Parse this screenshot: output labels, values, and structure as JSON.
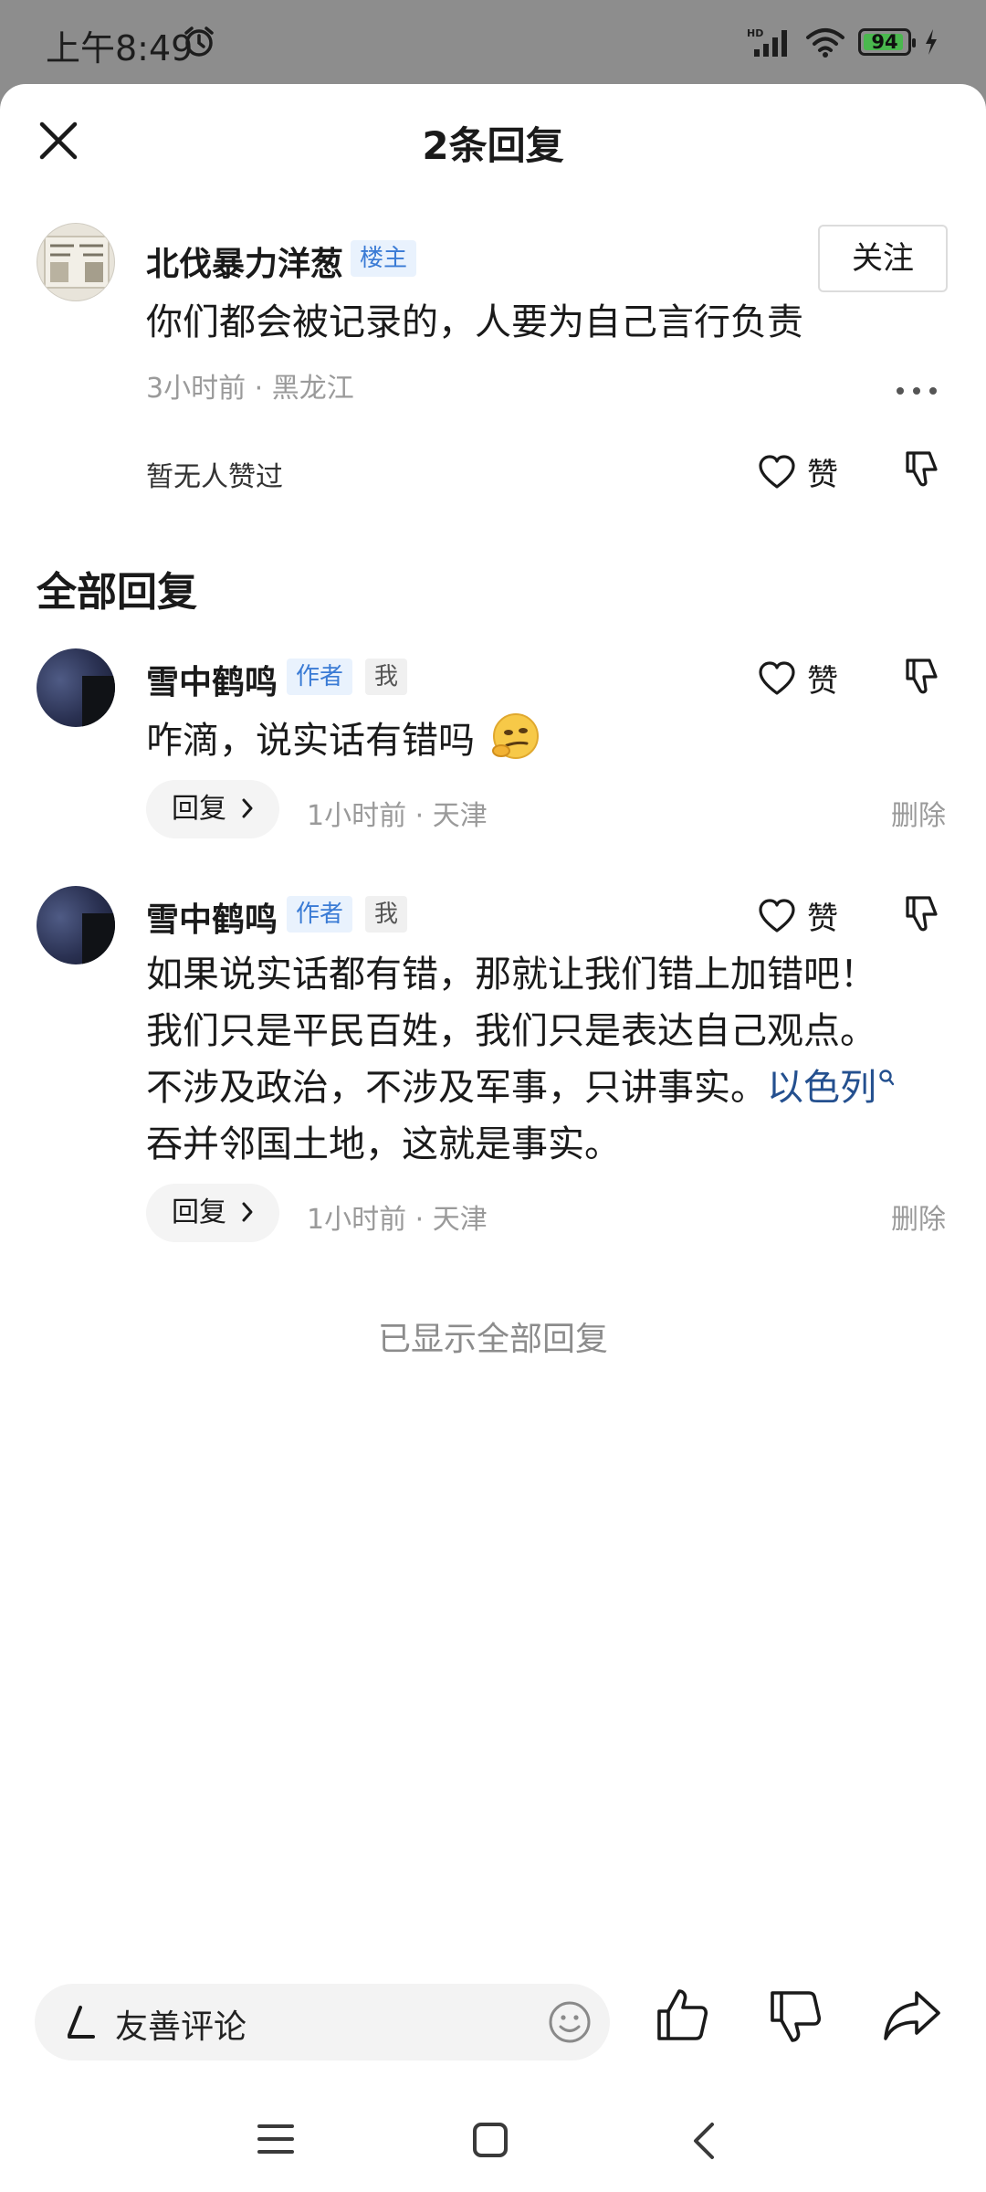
{
  "status_bar": {
    "time": "上午8:49",
    "battery_level": "94",
    "battery_percent": 94,
    "network": "HD",
    "battery_color": "#4ab84e"
  },
  "sheet": {
    "title": "2条回复",
    "close_icon": "close-icon"
  },
  "main_comment": {
    "user_name": "北伐暴力洋葱",
    "badge": "楼主",
    "follow_label": "关注",
    "content": "你们都会被记录的，人要为自己言行负责",
    "meta": "3小时前 · 黑龙江",
    "likes_text": "暂无人赞过",
    "like_label": "赞"
  },
  "replies_section": {
    "title": "全部回复"
  },
  "replies": [
    {
      "user_name": "雪中鹤鸣",
      "badge_author": "作者",
      "badge_me": "我",
      "content": "咋滴，说实话有错吗",
      "like_label": "赞",
      "reply_label": "回复",
      "meta": "1小时前 · 天津",
      "delete_label": "删除"
    },
    {
      "user_name": "雪中鹤鸣",
      "badge_author": "作者",
      "badge_me": "我",
      "content_line1": "如果说实话都有错，那就让我们错上加错吧！",
      "content_line2": "我们只是平民百姓，我们只是表达自己观点。",
      "content_line3_pre": "不涉及政治，不涉及军事，只讲事实。",
      "content_link": "以色列",
      "content_line4": "吞并邻国土地，这就是事实。",
      "like_label": "赞",
      "reply_label": "回复",
      "meta": "1小时前 · 天津",
      "delete_label": "删除"
    }
  ],
  "footer_note": "已显示全部回复",
  "bottom_bar": {
    "placeholder": "友善评论",
    "icons": [
      "pen-icon",
      "emoji-icon",
      "thumbs-up-icon",
      "thumbs-down-icon",
      "share-icon"
    ]
  },
  "nav_bar": {
    "icons": [
      "menu-icon",
      "home-icon",
      "back-icon"
    ]
  },
  "colors": {
    "accent_blue": "#3a7bd5",
    "link_blue": "#24508f",
    "muted_text": "#9a9a9a"
  }
}
